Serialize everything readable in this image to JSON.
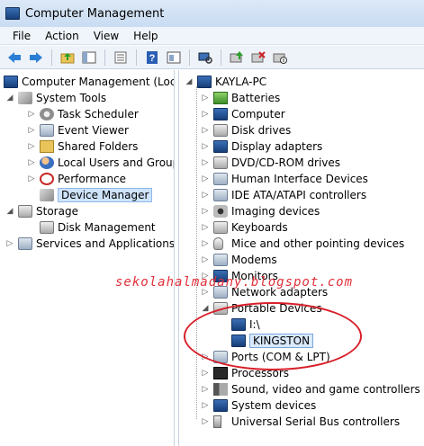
{
  "window": {
    "title": "Computer Management"
  },
  "menu": [
    "File",
    "Action",
    "View",
    "Help"
  ],
  "toolbar": {
    "buttons": [
      "back-icon",
      "forward-icon",
      "up-icon",
      "show-hide-tree-icon",
      "export-icon",
      "help-icon",
      "properties-icon",
      "scan-hardware-icon",
      "update-driver-icon",
      "uninstall-icon",
      "disable-icon"
    ]
  },
  "left_tree": {
    "root": "Computer Management (Local",
    "system_tools": "System Tools",
    "task_scheduler": "Task Scheduler",
    "event_viewer": "Event Viewer",
    "shared_folders": "Shared Folders",
    "local_users_groups": "Local Users and Groups",
    "performance": "Performance",
    "device_manager": "Device Manager",
    "storage": "Storage",
    "disk_management": "Disk Management",
    "services_apps": "Services and Applications"
  },
  "right_tree": {
    "root": "KAYLA-PC",
    "batteries": "Batteries",
    "computer": "Computer",
    "disk_drives": "Disk drives",
    "display_adapters": "Display adapters",
    "dvd": "DVD/CD-ROM drives",
    "hid": "Human Interface Devices",
    "ide": "IDE ATA/ATAPI controllers",
    "imaging": "Imaging devices",
    "keyboards": "Keyboards",
    "mice": "Mice and other pointing devices",
    "modems": "Modems",
    "monitors": "Monitors",
    "network": "Network adapters",
    "portable": "Portable Devices",
    "portable_i": "I:\\",
    "portable_kingston": "KINGSTON",
    "ports": "Ports (COM & LPT)",
    "processors": "Processors",
    "sound": "Sound, video and game controllers",
    "system_devices": "System devices",
    "usb": "Universal Serial Bus controllers"
  },
  "watermark": "sekolahalmadany.blogspot.com",
  "colors": {
    "annotation_red": "#d8202a",
    "selection_blue": "#cfe3fb"
  }
}
